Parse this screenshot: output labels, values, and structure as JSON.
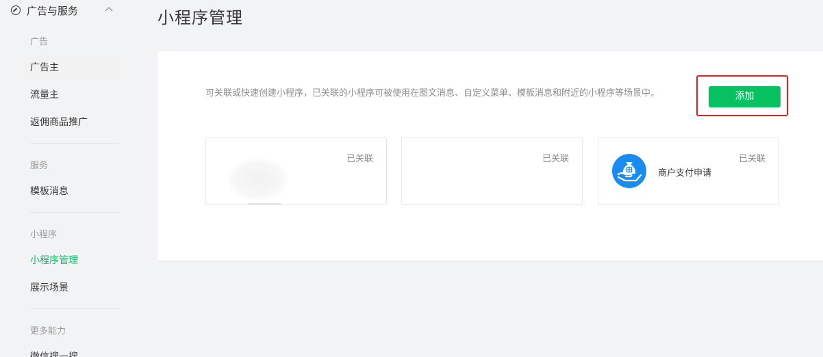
{
  "sidebar": {
    "group_title": "广告与服务",
    "sections": [
      {
        "title": "广告",
        "items": [
          "广告主",
          "流量主",
          "返佣商品推广"
        ]
      },
      {
        "title": "服务",
        "items": [
          "模板消息"
        ]
      },
      {
        "title": "小程序",
        "items": [
          "小程序管理",
          "展示场景"
        ]
      },
      {
        "title": "更多能力",
        "items": [
          "微信搜一搜"
        ]
      }
    ],
    "selected_item": "广告主",
    "active_item": "小程序管理"
  },
  "main": {
    "title": "小程序管理",
    "description": "可关联或快速创建小程序，已关联的小程序可被使用在图文消息、自定义菜单、模板消息和附近的小程序等场景中。",
    "add_button": "添加",
    "cards": [
      {
        "status": "已关联",
        "name": ""
      },
      {
        "status": "已关联",
        "name": ""
      },
      {
        "status": "已关联",
        "name": "商户支付申请",
        "icon": "merchant-payment-icon"
      }
    ]
  },
  "colors": {
    "accent": "#07c160",
    "highlight_border": "#e02020"
  }
}
